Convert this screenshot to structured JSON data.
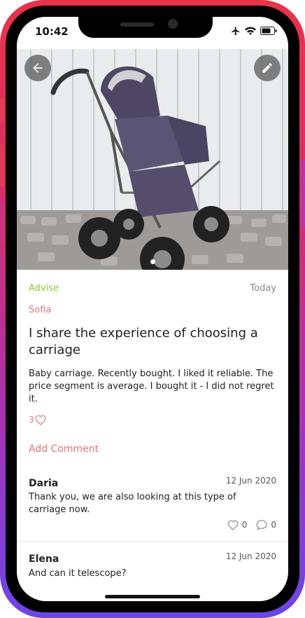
{
  "status": {
    "time": "10:42"
  },
  "photo": {
    "page_count": 1,
    "active_page": 1
  },
  "post": {
    "category": "Advise",
    "date": "Today",
    "author": "Sofia",
    "title": "I share the experience of choosing a carriage",
    "body": "Baby carriage. Recently bought. I liked it reliable. The price segment is average. I bought it - I did not regret it.",
    "likes": "3"
  },
  "actions": {
    "add_comment": "Add Comment"
  },
  "comments": [
    {
      "name": "Daria",
      "date": "12 Jun 2020",
      "text": "Thank you, we are also looking at this type of carriage now.",
      "likes": "0",
      "replies": "0"
    },
    {
      "name": "Elena",
      "date": "12 Jun 2020",
      "text": "And can it telescope?"
    }
  ],
  "colors": {
    "category": "#8cc63e",
    "accent": "#e07577",
    "frame_top": "#e8334a",
    "frame_bottom": "#6a46e6"
  }
}
